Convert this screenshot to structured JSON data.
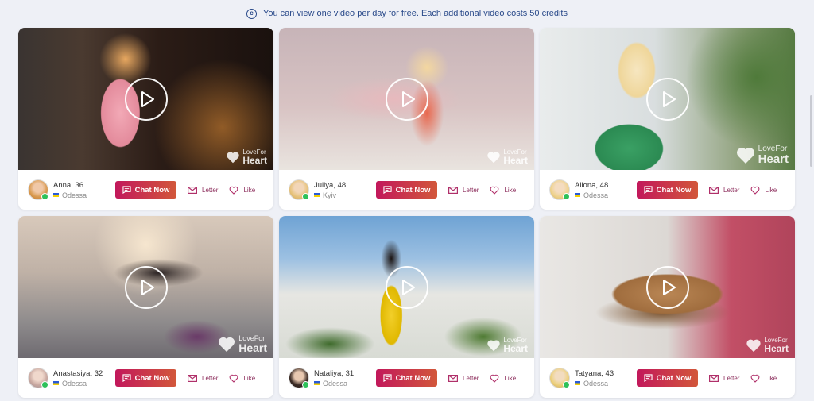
{
  "notice": {
    "text": "You can view one video per day for free. Each additional video costs 50 credits"
  },
  "brand": {
    "line1": "LoveFor",
    "line2": "Heart"
  },
  "actions": {
    "chat": "Chat Now",
    "letter": "Letter",
    "like": "Like"
  },
  "cards": [
    {
      "name": "Anna, 36",
      "city": "Odessa"
    },
    {
      "name": "Juliya, 48",
      "city": "Kyiv"
    },
    {
      "name": "Aliona, 48",
      "city": "Odessa"
    },
    {
      "name": "Anastasiya, 32",
      "city": "Odessa"
    },
    {
      "name": "Nataliya, 31",
      "city": "Odessa"
    },
    {
      "name": "Tatyana, 43",
      "city": "Odessa"
    }
  ],
  "colors": {
    "accent_start": "#c2185b",
    "accent_end": "#d2573a",
    "link": "#8b2b5a",
    "notice": "#2a4a8a"
  },
  "icons": {
    "notice": "copyright-circle-icon",
    "play": "play-icon",
    "chat": "chat-bubble-icon",
    "letter": "envelope-icon",
    "like": "heart-icon"
  }
}
